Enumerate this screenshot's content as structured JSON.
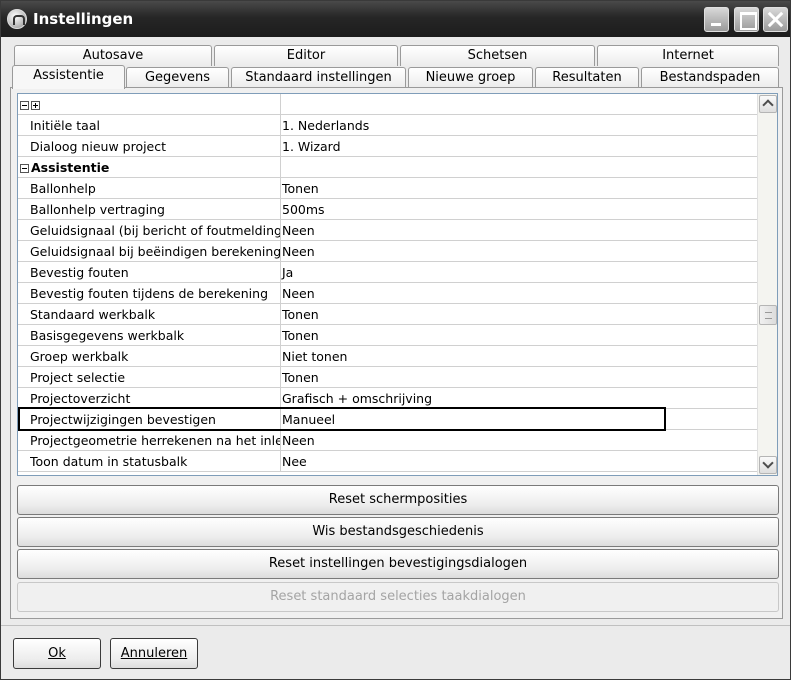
{
  "window": {
    "title": "Instellingen"
  },
  "tabs_back": [
    {
      "label": "Autosave"
    },
    {
      "label": "Editor"
    },
    {
      "label": "Schetsen"
    },
    {
      "label": "Internet"
    }
  ],
  "tabs_front": [
    {
      "label": "Assistentie",
      "active": true
    },
    {
      "label": "Gegevens"
    },
    {
      "label": "Standaard instellingen"
    },
    {
      "label": "Nieuwe groep"
    },
    {
      "label": "Resultaten"
    },
    {
      "label": "Bestandspaden"
    }
  ],
  "grid": {
    "rows": [
      {
        "name": "Initiële taal",
        "value": "1. Nederlands"
      },
      {
        "name": "Dialoog nieuw project",
        "value": "1. Wizard"
      },
      {
        "name": "Assistentie",
        "value": "",
        "category": true
      },
      {
        "name": "Ballonhelp",
        "value": "Tonen"
      },
      {
        "name": "Ballonhelp vertraging",
        "value": "500ms"
      },
      {
        "name": "Geluidsignaal (bij bericht of foutmelding)",
        "value": "Neen"
      },
      {
        "name": "Geluidsignaal bij beëindigen berekening",
        "value": "Neen"
      },
      {
        "name": "Bevestig fouten",
        "value": "Ja"
      },
      {
        "name": "Bevestig fouten tijdens de berekening",
        "value": "Neen"
      },
      {
        "name": "Standaard werkbalk",
        "value": "Tonen"
      },
      {
        "name": "Basisgegevens werkbalk",
        "value": "Tonen"
      },
      {
        "name": "Groep werkbalk",
        "value": "Niet tonen"
      },
      {
        "name": "Project selectie",
        "value": "Tonen"
      },
      {
        "name": "Projectoverzicht",
        "value": "Grafisch + omschrijving"
      },
      {
        "name": "Projectwijzigingen bevestigen",
        "value": "Manueel",
        "highlighted": true
      },
      {
        "name": "Projectgeometrie herrekenen na het inlezen",
        "value": "Neen"
      },
      {
        "name": "Toon datum in statusbalk",
        "value": "Nee"
      }
    ]
  },
  "actions": {
    "reset_screen": "Reset schermposities",
    "clear_history": "Wis bestandsgeschiedenis",
    "reset_confirm": "Reset instellingen bevestigingsdialogen",
    "reset_default": "Reset standaard selecties taakdialogen"
  },
  "footer": {
    "ok": "Ok",
    "cancel": "Annuleren"
  }
}
